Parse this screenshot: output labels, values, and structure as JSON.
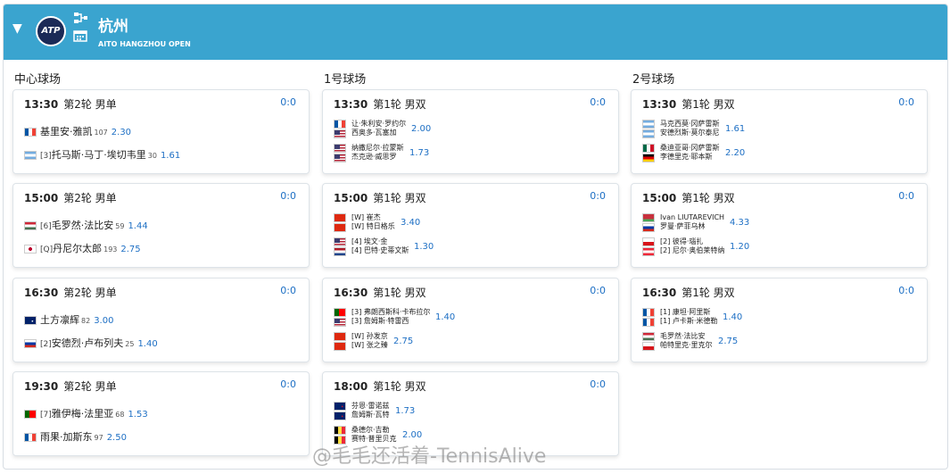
{
  "header": {
    "title": "杭州",
    "subtitle": "AITO HANGZHOU OPEN",
    "logo_text": "ATP",
    "accent": "#3aa4cf"
  },
  "columns": [
    {
      "title": "中心球场",
      "matches": [
        {
          "time": "13:30",
          "round": "第2轮 男单",
          "score": "0:0",
          "type": "singles",
          "players": [
            {
              "flag": "fr",
              "seed": "",
              "name": "基里安·雅凯",
              "rank": "107",
              "odds": "2.30"
            },
            {
              "flag": "ar",
              "seed": "[3]",
              "name": "托马斯·马丁·埃切韦里",
              "rank": "30",
              "odds": "1.61"
            }
          ]
        },
        {
          "time": "15:00",
          "round": "第2轮 男单",
          "score": "0:0",
          "type": "singles",
          "players": [
            {
              "flag": "hu",
              "seed": "[6]",
              "name": "毛罗然·法比安",
              "rank": "59",
              "odds": "1.44"
            },
            {
              "flag": "jp",
              "seed": "[Q]",
              "name": "丹尼尔太郎",
              "rank": "193",
              "odds": "2.75"
            }
          ]
        },
        {
          "time": "16:30",
          "round": "第2轮 男单",
          "score": "0:0",
          "type": "singles",
          "players": [
            {
              "flag": "au",
              "seed": "",
              "name": "土方凛辉",
              "rank": "82",
              "odds": "3.00"
            },
            {
              "flag": "ru",
              "seed": "[2]",
              "name": "安德烈·卢布列夫",
              "rank": "25",
              "odds": "1.40"
            }
          ]
        },
        {
          "time": "19:30",
          "round": "第2轮 男单",
          "score": "0:0",
          "type": "singles",
          "players": [
            {
              "flag": "pt",
              "seed": "[7]",
              "name": "雅伊梅·法里亚",
              "rank": "68",
              "odds": "1.53"
            },
            {
              "flag": "fr",
              "seed": "",
              "name": "雨果·加斯东",
              "rank": "97",
              "odds": "2.50"
            }
          ]
        }
      ]
    },
    {
      "title": "1号球场",
      "matches": [
        {
          "time": "13:30",
          "round": "第1轮 男双",
          "score": "0:0",
          "type": "doubles",
          "teams": [
            {
              "flags": [
                "fr",
                "us"
              ],
              "names": [
                "让·朱利安·罗约尔",
                "西奥多·瓦塞加"
              ],
              "odds": "2.00"
            },
            {
              "flags": [
                "us",
                "us"
              ],
              "names": [
                "纳撒尼尔·拉蒙斯",
                "杰克逊·威思罗"
              ],
              "odds": "1.73"
            }
          ]
        },
        {
          "time": "15:00",
          "round": "第1轮 男双",
          "score": "0:0",
          "type": "doubles",
          "teams": [
            {
              "flags": [
                "cn",
                "cn"
              ],
              "names": [
                "[W] 崔杰",
                "[W] 特日格乐"
              ],
              "odds": "3.40"
            },
            {
              "flags": [
                "us",
                "nl"
              ],
              "names": [
                "[4] 埃文·金",
                "[4] 巴特·史蒂文斯"
              ],
              "odds": "1.30"
            }
          ]
        },
        {
          "time": "16:30",
          "round": "第1轮 男双",
          "score": "0:0",
          "type": "doubles",
          "teams": [
            {
              "flags": [
                "pt",
                "us"
              ],
              "names": [
                "[3] 弗朗西斯科·卡布拉尔",
                "[3] 詹姆斯·特雷西"
              ],
              "odds": "1.40"
            },
            {
              "flags": [
                "cn",
                "cn"
              ],
              "names": [
                "[W] 孙发京",
                "[W] 张之臻"
              ],
              "odds": "2.75"
            }
          ]
        },
        {
          "time": "18:00",
          "round": "第1轮 男双",
          "score": "0:0",
          "type": "doubles",
          "teams": [
            {
              "flags": [
                "nz",
                "nz"
              ],
              "names": [
                "芬恩·雷诺兹",
                "詹姆斯·瓦特"
              ],
              "odds": "1.73"
            },
            {
              "flags": [
                "be",
                "be"
              ],
              "names": [
                "桑德尔·吉勒",
                "赛特·普里贝克"
              ],
              "odds": "2.00"
            }
          ]
        }
      ]
    },
    {
      "title": "2号球场",
      "matches": [
        {
          "time": "13:30",
          "round": "第1轮 男双",
          "score": "0:0",
          "type": "doubles",
          "teams": [
            {
              "flags": [
                "ar",
                "ar"
              ],
              "names": [
                "马克西莫·冈萨雷斯",
                "安德烈斯·莫尔泰尼"
              ],
              "odds": "1.61"
            },
            {
              "flags": [
                "mx",
                "de"
              ],
              "names": [
                "桑迪亚哥·冈萨雷斯",
                "李德里克·耶本斯"
              ],
              "odds": "2.20"
            }
          ]
        },
        {
          "time": "15:00",
          "round": "第1轮 男双",
          "score": "0:0",
          "type": "doubles",
          "teams": [
            {
              "flags": [
                "by",
                "ru"
              ],
              "names": [
                "Ivan LIUTAREVICH",
                "罗曼·萨菲乌林"
              ],
              "odds": "4.33"
            },
            {
              "flags": [
                "cz",
                "at"
              ],
              "names": [
                "[2] 彼得·瑙扎",
                "[2] 尼尔·奥伯莱特纳"
              ],
              "odds": "1.20"
            }
          ]
        },
        {
          "time": "16:30",
          "round": "第1轮 男双",
          "score": "0:0",
          "type": "doubles",
          "teams": [
            {
              "flags": [
                "fr",
                "fr"
              ],
              "names": [
                "[1] 康坦·阿里斯",
                "[1] 卢卡斯·米德勒"
              ],
              "odds": "1.40"
            },
            {
              "flags": [
                "hu",
                "cz"
              ],
              "names": [
                "毛罗然·法比安",
                "帕特里克·里克尔"
              ],
              "odds": "2.75"
            }
          ]
        }
      ]
    }
  ],
  "watermark": "@毛毛还活着-TennisAlive"
}
